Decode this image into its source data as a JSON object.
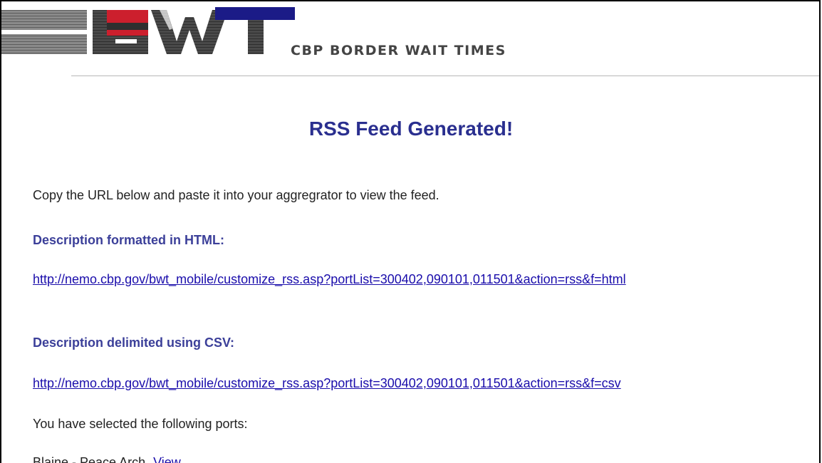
{
  "header": {
    "logo_text": "BWT",
    "caption": "CBP BORDER WAIT TIMES"
  },
  "main": {
    "title": "RSS Feed Generated!",
    "instruction": "Copy the URL below and paste it into your aggregrator to view the feed.",
    "html_heading": "Description formatted in HTML:",
    "html_url": "http://nemo.cbp.gov/bwt_mobile/customize_rss.asp?portList=300402,090101,011501&action=rss&f=html",
    "csv_heading": "Description delimited using CSV:",
    "csv_url": "http://nemo.cbp.gov/bwt_mobile/customize_rss.asp?portList=300402,090101,011501&action=rss&f=csv",
    "ports_intro": "You have selected the following ports:",
    "ports": [
      {
        "name": "Blaine - Peace Arch",
        "view_label": "View"
      }
    ]
  },
  "colors": {
    "title": "#2a2f8f",
    "heading": "#3b3f99",
    "link": "#1a0dab",
    "logo_red": "#cc1f2d",
    "logo_navy": "#1b1b87",
    "logo_gray": "#6d6d6d"
  }
}
